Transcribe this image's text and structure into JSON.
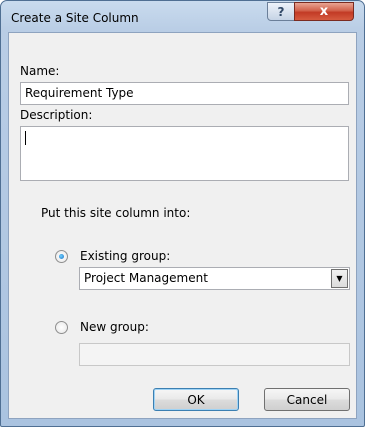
{
  "window": {
    "title": "Create a Site Column",
    "help_label": "?",
    "close_label": "x"
  },
  "form": {
    "name_label": "Name:",
    "name_value": "Requirement Type",
    "description_label": "Description:",
    "description_value": "",
    "put_into_label": "Put this site column into:",
    "existing_group_label": "Existing group:",
    "existing_group_selected": true,
    "existing_group_value": "Project Management",
    "new_group_label": "New group:",
    "new_group_selected": false,
    "new_group_value": ""
  },
  "buttons": {
    "ok_label": "OK",
    "cancel_label": "Cancel"
  },
  "colors": {
    "titlebar": "#b9cde5",
    "close_button": "#c23a25",
    "dialog_background": "#f0f0f0",
    "default_button_border": "#3c7fb1"
  }
}
